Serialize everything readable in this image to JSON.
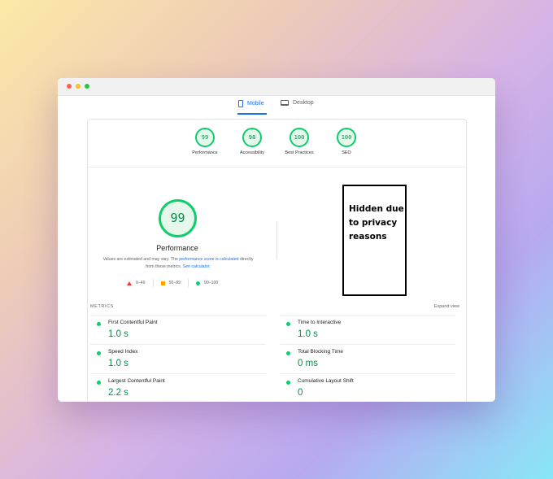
{
  "tabs": {
    "mobile": "Mobile",
    "desktop": "Desktop"
  },
  "categories": [
    {
      "score": "99",
      "label": "Performance"
    },
    {
      "score": "98",
      "label": "Accessibility"
    },
    {
      "score": "100",
      "label": "Best Practices"
    },
    {
      "score": "100",
      "label": "SEO"
    }
  ],
  "performance": {
    "score": "99",
    "title": "Performance",
    "note_prefix": "Values are estimated and may vary. The ",
    "note_link1": "performance score is calculated",
    "note_middle": " directly from these metrics. ",
    "note_link2": "See calculator."
  },
  "legend": {
    "fail": "0–49",
    "average": "50–89",
    "pass": "90–100"
  },
  "privacy_box": "Hidden due to privacy reasons",
  "metrics": {
    "heading": "METRICS",
    "expand": "Expand view",
    "items": [
      {
        "label": "First Contentful Paint",
        "value": "1.0 s"
      },
      {
        "label": "Time to Interactive",
        "value": "1.0 s"
      },
      {
        "label": "Speed Index",
        "value": "1.0 s"
      },
      {
        "label": "Total Blocking Time",
        "value": "0 ms"
      },
      {
        "label": "Largest Contentful Paint",
        "value": "2.2 s"
      },
      {
        "label": "Cumulative Layout Shift",
        "value": "0"
      }
    ]
  },
  "colors": {
    "pass": "#0cce6b",
    "average": "#ffa400",
    "fail": "#ff3333",
    "link": "#1a73e8"
  }
}
